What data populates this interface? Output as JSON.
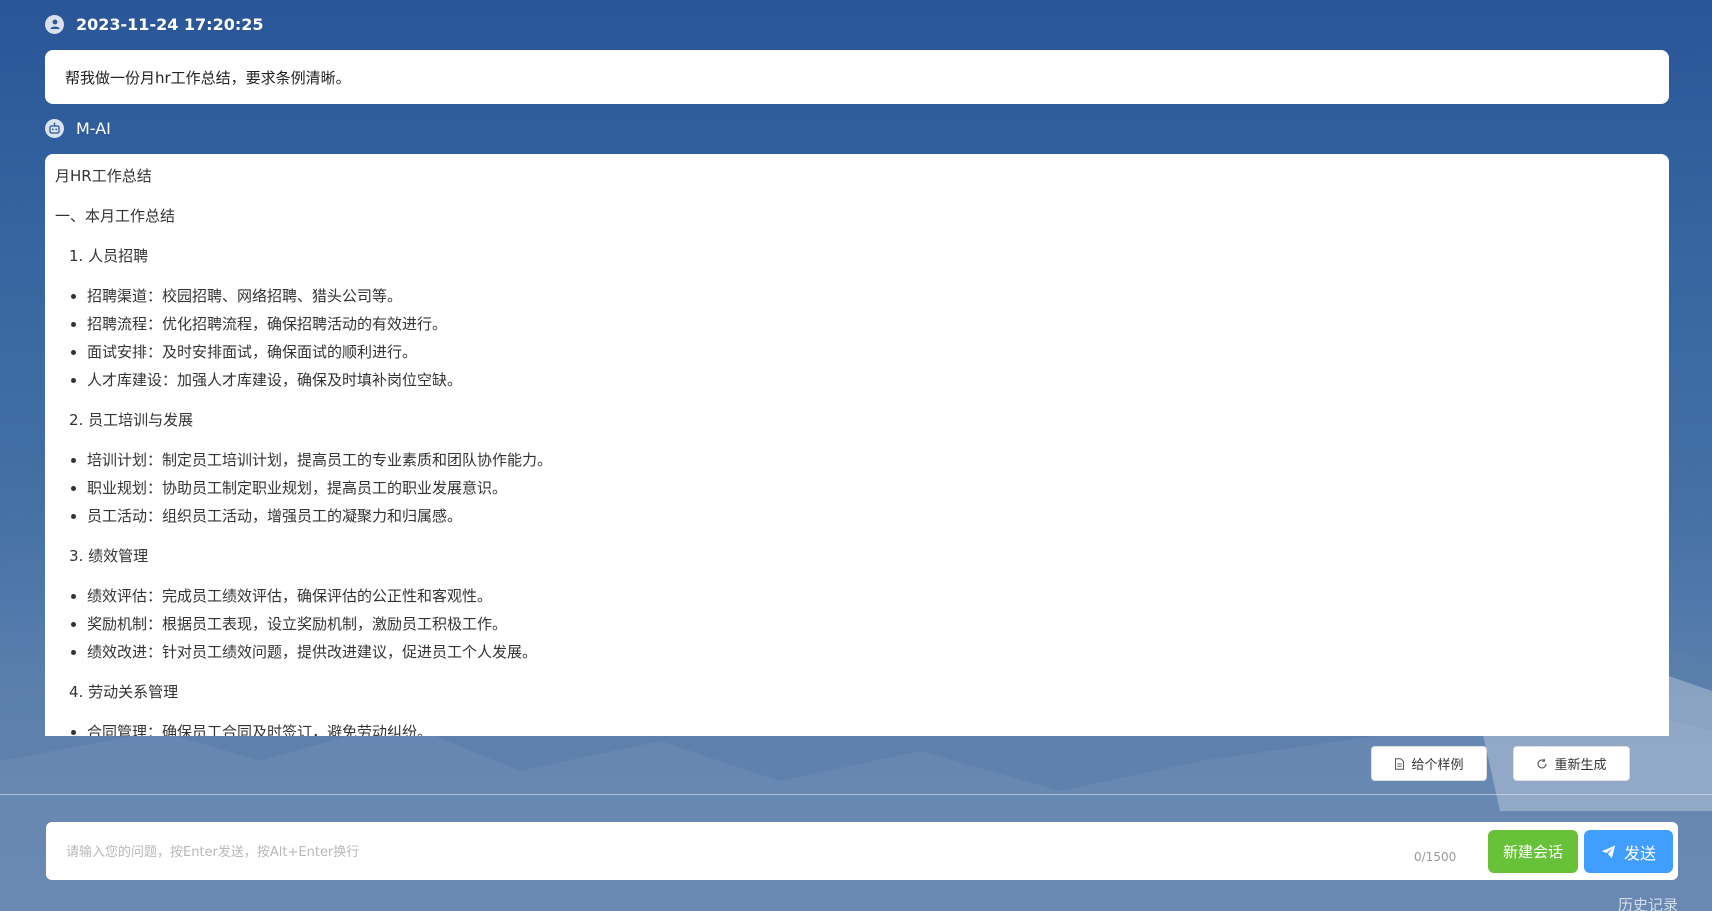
{
  "user_message": {
    "icon": "user-icon",
    "timestamp": "2023-11-24 17:20:25",
    "text": "帮我做一份月hr工作总结，要求条例清晰。"
  },
  "ai_message": {
    "icon": "robot-icon",
    "name": "M-AI",
    "title": "月HR工作总结",
    "section1": "一、本月工作总结",
    "sub1": "1. 人员招聘",
    "list1": [
      "招聘渠道：校园招聘、网络招聘、猎头公司等。",
      "招聘流程：优化招聘流程，确保招聘活动的有效进行。",
      "面试安排：及时安排面试，确保面试的顺利进行。",
      "人才库建设：加强人才库建设，确保及时填补岗位空缺。"
    ],
    "sub2": "2. 员工培训与发展",
    "list2": [
      "培训计划：制定员工培训计划，提高员工的专业素质和团队协作能力。",
      "职业规划：协助员工制定职业规划，提高员工的职业发展意识。",
      "员工活动：组织员工活动，增强员工的凝聚力和归属感。"
    ],
    "sub3": "3. 绩效管理",
    "list3": [
      "绩效评估：完成员工绩效评估，确保评估的公正性和客观性。",
      "奖励机制：根据员工表现，设立奖励机制，激励员工积极工作。",
      "绩效改进：针对员工绩效问题，提供改进建议，促进员工个人发展。"
    ],
    "sub4": "4. 劳动关系管理",
    "list4": [
      "合同管理：确保员工合同及时签订，避免劳动纠纷。"
    ]
  },
  "actions": {
    "example_label": "给个样例",
    "example_icon": "document-icon",
    "regenerate_label": "重新生成",
    "regenerate_icon": "refresh-icon"
  },
  "input": {
    "placeholder": "请输入您的问题，按Enter发送，按Alt+Enter换行",
    "value": "",
    "counter": "0/1500",
    "new_chat_label": "新建会话",
    "send_label": "发送",
    "send_icon": "paper-plane-icon"
  },
  "history_label": "历史记录",
  "colors": {
    "new_chat_button": "#67c23a",
    "send_button": "#409eff"
  }
}
